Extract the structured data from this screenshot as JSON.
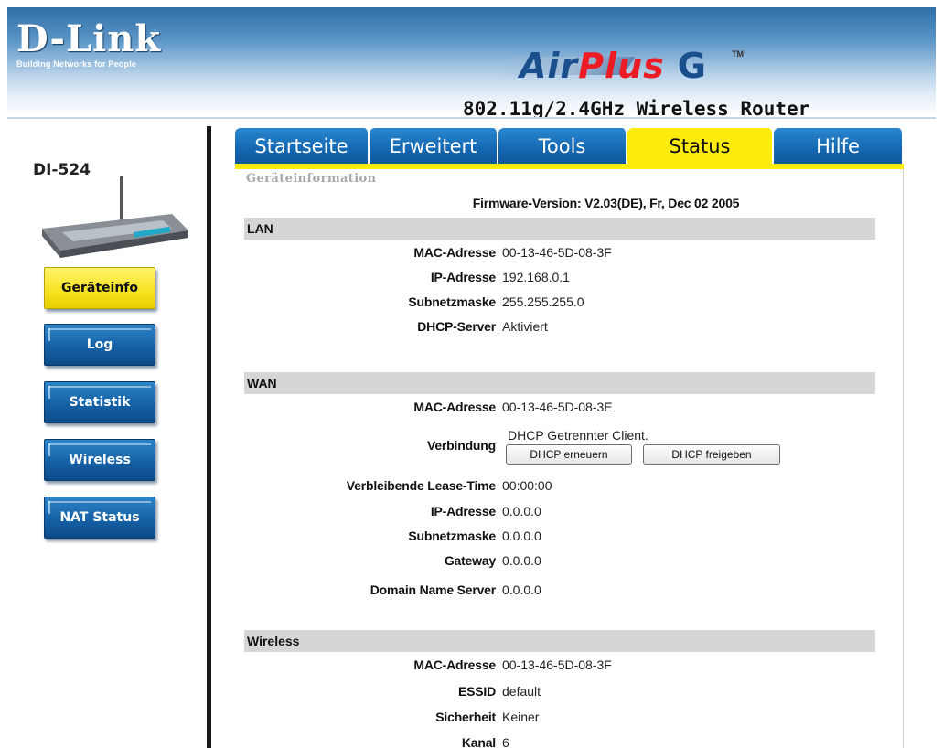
{
  "header": {
    "brand_name": "D-Link",
    "brand_tagline": "Building Networks for People",
    "product_air": "Air",
    "product_plus": "Plus",
    "product_g": "G",
    "product_tm": "TM",
    "model_description": "802.11g/2.4GHz Wireless Router"
  },
  "sidebar": {
    "model": "DI-524",
    "items": [
      {
        "label": "Geräteinfo",
        "active": true
      },
      {
        "label": "Log"
      },
      {
        "label": "Statistik"
      },
      {
        "label": "Wireless"
      },
      {
        "label": "NAT Status"
      }
    ]
  },
  "tabs": [
    {
      "label": "Startseite"
    },
    {
      "label": "Erweitert"
    },
    {
      "label": "Tools"
    },
    {
      "label": "Status",
      "active": true
    },
    {
      "label": "Hilfe"
    }
  ],
  "content": {
    "page_title": "Geräteinformation",
    "firmware": "Firmware-Version: V2.03(DE), Fr, Dec 02 2005",
    "lan": {
      "title": "LAN",
      "rows": [
        {
          "label": "MAC-Adresse",
          "value": "00-13-46-5D-08-3F"
        },
        {
          "label": "IP-Adresse",
          "value": "192.168.0.1"
        },
        {
          "label": "Subnetzmaske",
          "value": "255.255.255.0"
        },
        {
          "label": "DHCP-Server",
          "value": "Aktiviert"
        }
      ]
    },
    "wan": {
      "title": "WAN",
      "mac_label": "MAC-Adresse",
      "mac_value": "00-13-46-5D-08-3E",
      "connection_label": "Verbindung",
      "connection_value": "DHCP Getrennter Client.",
      "renew_button": "DHCP erneuern",
      "release_button": "DHCP freigeben",
      "rows": [
        {
          "label": "Verbleibende Lease-Time",
          "value": "00:00:00"
        },
        {
          "label": "IP-Adresse",
          "value": "0.0.0.0"
        },
        {
          "label": "Subnetzmaske",
          "value": "0.0.0.0"
        },
        {
          "label": "Gateway",
          "value": "0.0.0.0"
        },
        {
          "label": "Domain Name Server",
          "value": "0.0.0.0"
        }
      ]
    },
    "wireless": {
      "title": "Wireless",
      "rows": [
        {
          "label": "MAC-Adresse",
          "value": "00-13-46-5D-08-3F"
        },
        {
          "label": "ESSID",
          "value": "default"
        },
        {
          "label": "Sicherheit",
          "value": "Keiner"
        },
        {
          "label": "Kanal",
          "value": "6"
        }
      ]
    }
  },
  "colors": {
    "tab_blue": "#1467b0",
    "active_yellow": "#fcec0e",
    "section_gray": "#d6d6d6",
    "brand_red": "#ec1b24"
  }
}
